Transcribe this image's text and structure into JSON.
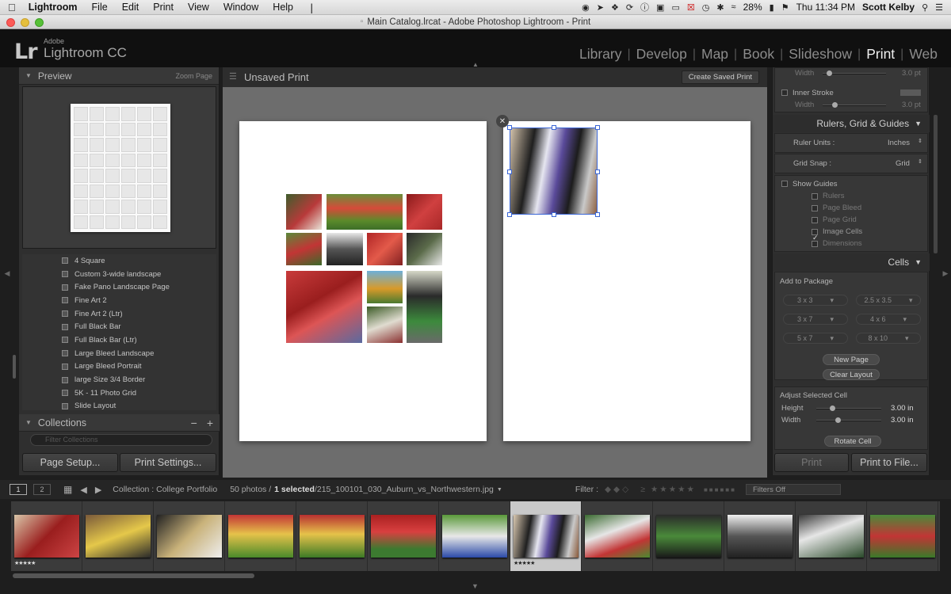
{
  "menubar": {
    "app": "Lightroom",
    "items": [
      "File",
      "Edit",
      "Print",
      "View",
      "Window",
      "Help"
    ],
    "battery": "28%",
    "clock": "Thu 11:34 PM",
    "user": "Scott Kelby"
  },
  "window": {
    "title": "Main Catalog.lrcat - Adobe Photoshop Lightroom - Print"
  },
  "header": {
    "logo": "Lr",
    "brand": "Adobe",
    "product": "Lightroom CC",
    "modules": [
      "Library",
      "Develop",
      "Map",
      "Book",
      "Slideshow",
      "Print",
      "Web"
    ],
    "active_module": "Print"
  },
  "left_panel": {
    "preview_title": "Preview",
    "zoom_label": "Zoom Page",
    "templates": [
      "4 Square",
      "Custom 3-wide landscape",
      "Fake Pano Landscape Page",
      "Fine Art 2",
      "Fine Art 2 (Ltr)",
      "Full Black Bar",
      "Full Black Bar (Ltr)",
      "Large Bleed Landscape",
      "Large Bleed Portrait",
      "large Size 3/4 Border",
      "5K - 11 Photo Grid",
      "Slide Layout"
    ],
    "collections_title": "Collections",
    "collections_minus": "−",
    "collections_plus": "+",
    "filter_placeholder": "Filter Collections",
    "page_setup": "Page Setup...",
    "print_settings": "Print Settings..."
  },
  "canvas": {
    "title": "Unsaved Print",
    "create_saved": "Create Saved Print"
  },
  "right_panel": {
    "width_label": "Width",
    "width_value": "3.0 pt",
    "inner_stroke": "Inner Stroke",
    "rulers_title": "Rulers, Grid & Guides",
    "ruler_units_label": "Ruler Units :",
    "ruler_units_value": "Inches",
    "grid_snap_label": "Grid Snap :",
    "grid_snap_value": "Grid",
    "show_guides": "Show Guides",
    "guides": [
      "Rulers",
      "Page Bleed",
      "Page Grid",
      "Image Cells",
      "Dimensions"
    ],
    "guides_checked": [
      false,
      false,
      false,
      true,
      false
    ],
    "cells_title": "Cells",
    "add_to_package": "Add to Package",
    "sizes": [
      "3 x 3",
      "2.5 x 3.5",
      "3 x 7",
      "4 x 6",
      "5 x 7",
      "8 x 10"
    ],
    "new_page": "New Page",
    "clear_layout": "Clear Layout",
    "adjust_cell": "Adjust Selected Cell",
    "height_label": "Height",
    "height_value": "3.00 in",
    "width2_label": "Width",
    "width2_value": "3.00 in",
    "rotate_cell": "Rotate Cell",
    "print_btn": "Print",
    "print_to_file": "Print to File..."
  },
  "filmstrip": {
    "page1": "1",
    "page2": "2",
    "collection": "Collection : College Portfolio",
    "count_prefix": "50 photos /",
    "selected": "1 selected",
    "filename": "/215_100101_030_Auburn_vs_Northwestern.jpg",
    "filter_label": "Filter :",
    "filters_off": "Filters Off",
    "stars_mark": "★★★★★",
    "star_thumbs": [
      0,
      7
    ]
  }
}
